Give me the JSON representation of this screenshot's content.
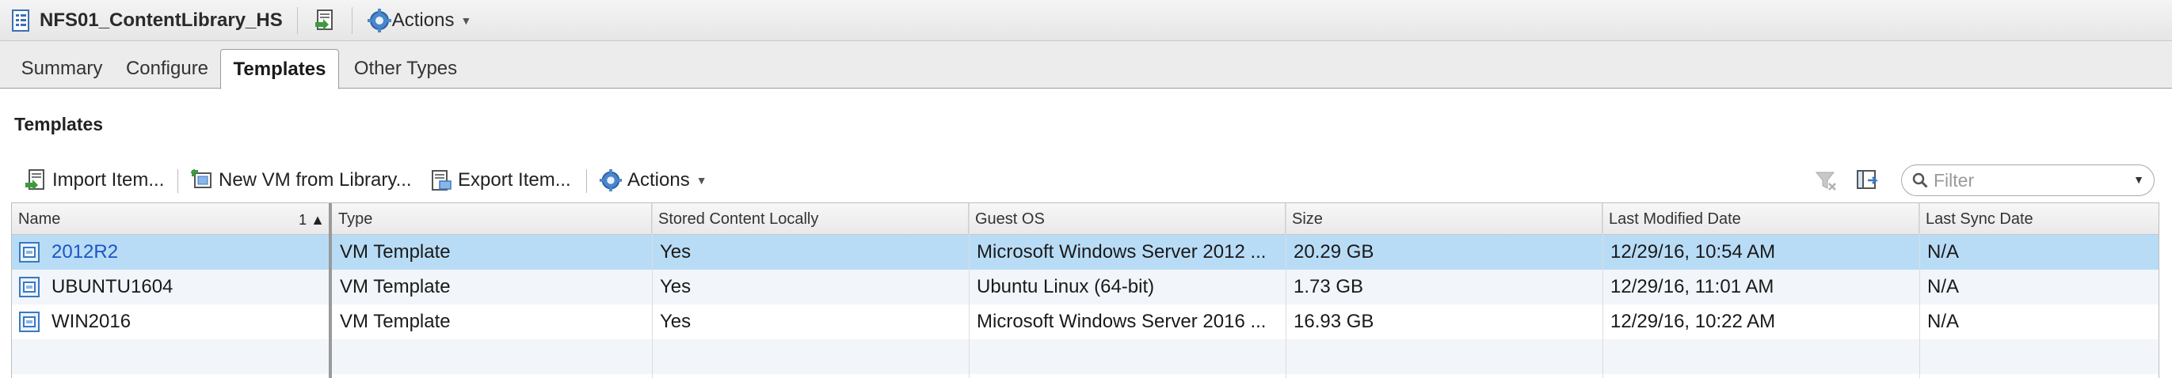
{
  "window": {
    "title": "NFS01_ContentLibrary_HS",
    "actions_label": "Actions"
  },
  "tabs": [
    {
      "label": "Summary",
      "active": false
    },
    {
      "label": "Configure",
      "active": false
    },
    {
      "label": "Templates",
      "active": true
    },
    {
      "label": "Other Types",
      "active": false
    }
  ],
  "section": {
    "heading": "Templates"
  },
  "toolbar": {
    "import_label": "Import Item...",
    "new_vm_label": "New VM from Library...",
    "export_label": "Export Item...",
    "actions_label": "Actions",
    "filter_placeholder": "Filter"
  },
  "table": {
    "columns": [
      "Name",
      "Type",
      "Stored Content Locally",
      "Guest OS",
      "Size",
      "Last Modified Date",
      "Last Sync Date"
    ],
    "sort_indicator": "1",
    "rows": [
      {
        "name": "2012R2",
        "type": "VM Template",
        "stored": "Yes",
        "guest_os": "Microsoft Windows Server 2012 ...",
        "size": "20.29  GB",
        "modified": "12/29/16, 10:54 AM",
        "sync": "N/A",
        "selected": true
      },
      {
        "name": "UBUNTU1604",
        "type": "VM Template",
        "stored": "Yes",
        "guest_os": "Ubuntu Linux (64-bit)",
        "size": "1.73  GB",
        "modified": "12/29/16, 11:01 AM",
        "sync": "N/A",
        "selected": false
      },
      {
        "name": "WIN2016",
        "type": "VM Template",
        "stored": "Yes",
        "guest_os": "Microsoft Windows Server 2016 ...",
        "size": "16.93  GB",
        "modified": "12/29/16, 10:22 AM",
        "sync": "N/A",
        "selected": false
      }
    ]
  },
  "colors": {
    "selected_row": "#b9dcf6",
    "link": "#1a55c8",
    "icon_blue": "#3a78c2"
  }
}
